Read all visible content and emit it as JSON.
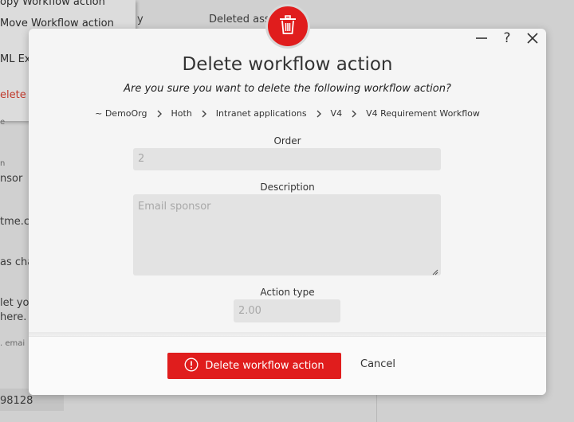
{
  "background": {
    "menu": [
      "opy Workflow action",
      "Move Workflow action",
      "ML Ex",
      "elete"
    ],
    "header_text": [
      "y",
      "Deleted ass"
    ],
    "left_snippets": [
      "e",
      "n",
      "nsor",
      "tme.co",
      "as cha",
      "let you",
      "here.",
      ". emai",
      "98128"
    ]
  },
  "modal": {
    "title": "Delete workflow action",
    "subtitle": "Are you sure you want to delete the following workflow action?",
    "breadcrumb": [
      "~ DemoOrg",
      "Hoth",
      "Intranet applications",
      "V4",
      "V4 Requirement Workflow"
    ],
    "fields": {
      "order_label": "Order",
      "order_value": "2",
      "description_label": "Description",
      "description_value": "Email sponsor",
      "action_type_label": "Action type",
      "action_type_value": "2.00"
    },
    "buttons": {
      "delete_label": "Delete workflow action",
      "cancel_label": "Cancel"
    }
  },
  "colors": {
    "accent": "#e01d1d",
    "badge_border": "#d8d8d8"
  },
  "icons": [
    "trash-icon",
    "minimize-icon",
    "help-icon",
    "close-icon",
    "chevron-right-icon",
    "alert-circle-icon"
  ]
}
